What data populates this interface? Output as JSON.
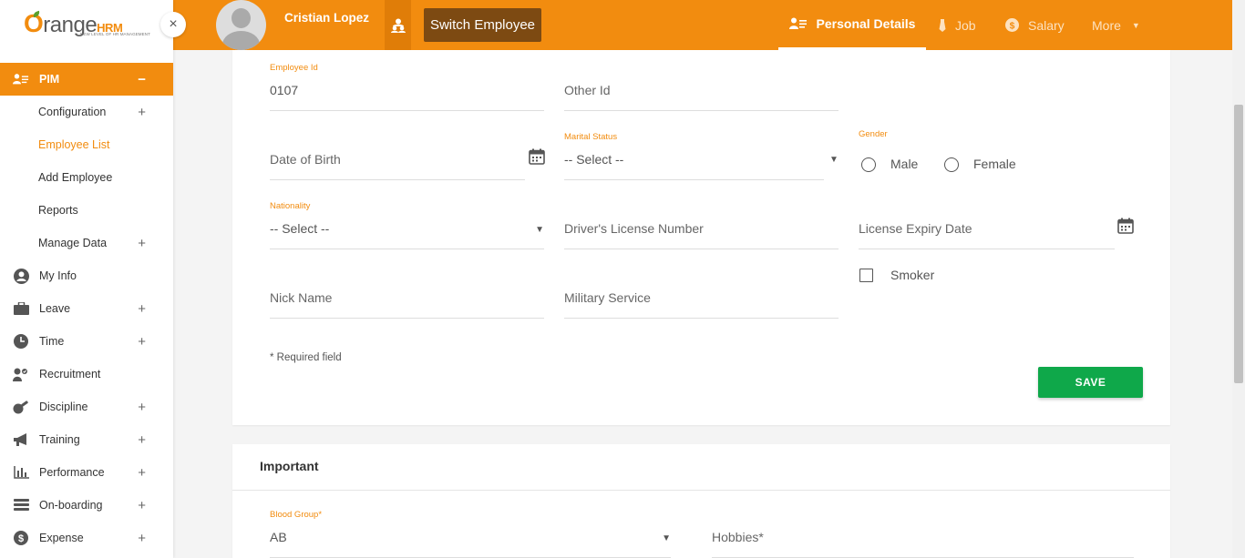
{
  "brand": {
    "logo_main": "range",
    "logo_o": "O",
    "logo_hrm": "HRM",
    "logo_tagline": "NEW LEVEL OF HR MANAGEMENT",
    "accent_color": "#f28c0f",
    "save_color": "#0fa84a"
  },
  "sidebar": {
    "close_glyph": "×",
    "menu": [
      {
        "label": "PIM",
        "icon": "pim-icon",
        "toggle": "−",
        "active": true
      },
      {
        "label": "My Info",
        "icon": "user-circle-icon"
      },
      {
        "label": "Leave",
        "icon": "briefcase-icon",
        "toggle": "+"
      },
      {
        "label": "Time",
        "icon": "clock-icon",
        "toggle": "+"
      },
      {
        "label": "Recruitment",
        "icon": "recruitment-icon"
      },
      {
        "label": "Discipline",
        "icon": "discipline-icon",
        "toggle": "+"
      },
      {
        "label": "Training",
        "icon": "megaphone-icon",
        "toggle": "+"
      },
      {
        "label": "Performance",
        "icon": "bar-chart-icon",
        "toggle": "+"
      },
      {
        "label": "On-boarding",
        "icon": "stack-icon",
        "toggle": "+"
      },
      {
        "label": "Expense",
        "icon": "dollar-icon",
        "toggle": "+"
      }
    ],
    "pim_sub": [
      {
        "label": "Configuration",
        "toggle": "+"
      },
      {
        "label": "Employee List",
        "selected": true
      },
      {
        "label": "Add Employee"
      },
      {
        "label": "Reports"
      },
      {
        "label": "Manage Data",
        "toggle": "+"
      }
    ]
  },
  "topbar": {
    "employee_name": "Cristian Lopez",
    "switch_label": "Switch Employee",
    "tabs": {
      "personal": "Personal Details",
      "job": "Job",
      "salary": "Salary",
      "more": "More"
    }
  },
  "form": {
    "employee_id": {
      "label": "Employee Id",
      "value": "0107"
    },
    "other_id": {
      "placeholder": "Other Id"
    },
    "dob": {
      "placeholder": "Date of Birth"
    },
    "marital_status": {
      "label": "Marital Status",
      "value": "-- Select --"
    },
    "gender": {
      "label": "Gender",
      "options": [
        "Male",
        "Female"
      ]
    },
    "nationality": {
      "label": "Nationality",
      "value": "-- Select --"
    },
    "drivers_license": {
      "placeholder": "Driver's License Number"
    },
    "license_expiry": {
      "placeholder": "License Expiry Date"
    },
    "smoker": {
      "label": "Smoker"
    },
    "nick_name": {
      "placeholder": "Nick Name"
    },
    "military_service": {
      "placeholder": "Military Service"
    },
    "required_note": "* Required field",
    "save_label": "SAVE"
  },
  "important": {
    "title": "Important",
    "blood_group": {
      "label": "Blood Group*",
      "value": "AB"
    },
    "hobbies": {
      "placeholder": "Hobbies*"
    }
  }
}
